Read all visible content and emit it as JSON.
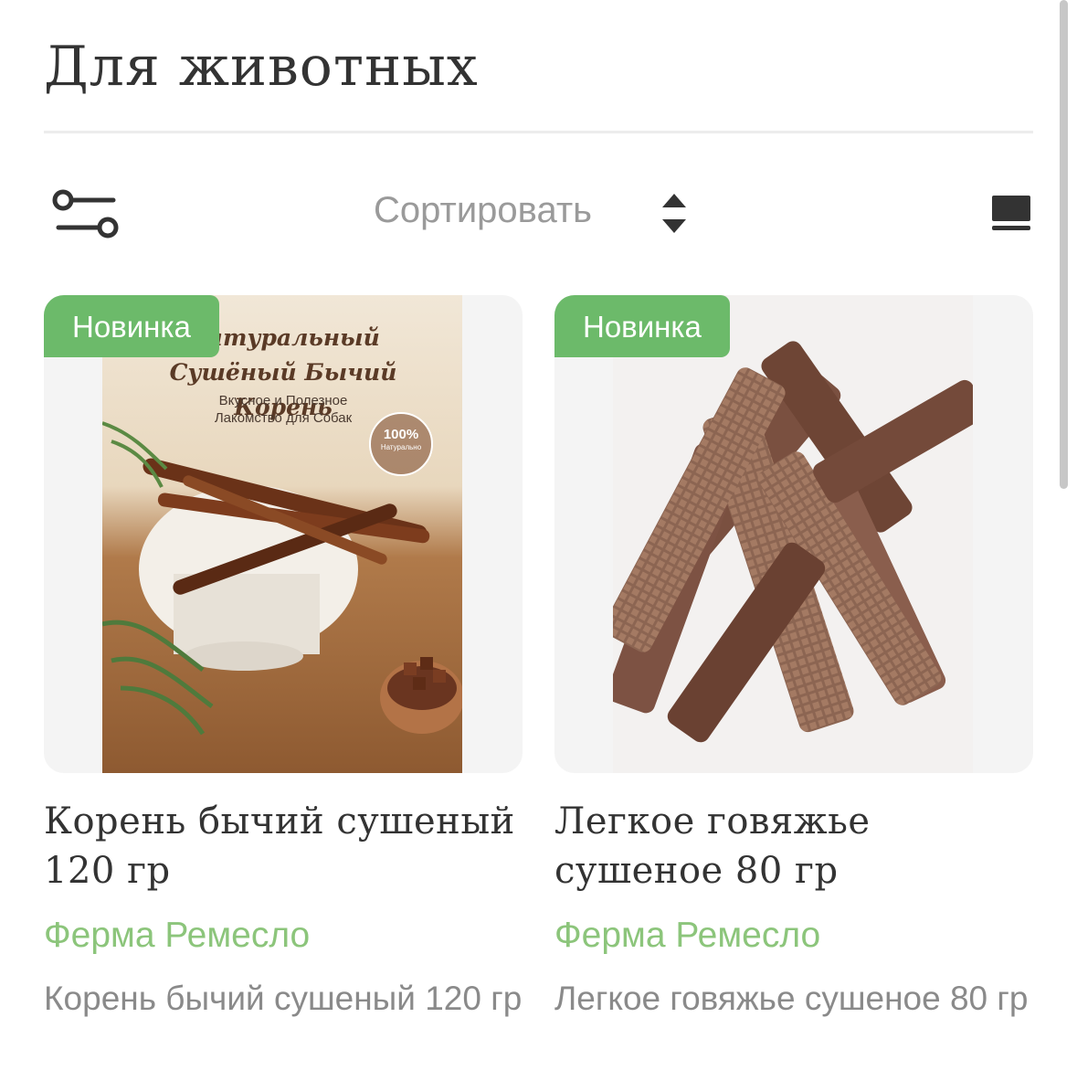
{
  "page": {
    "title": "Для животных"
  },
  "toolbar": {
    "filter_icon": "sliders-icon",
    "sort_label": "Сортировать",
    "sort_icon": "sort-up-down-icon",
    "view_icon": "view-mode-icon"
  },
  "colors": {
    "accent": "#6cba6a",
    "brand_text": "#8cc57b",
    "text": "#333333",
    "muted": "#8a8a8a"
  },
  "products": [
    {
      "badge": "Новинка",
      "title": "Корень бычий сушеный 120 гр",
      "brand": "Ферма Ремесло",
      "description": "Корень бычий сушеный 120 гр",
      "image": {
        "heading_line1": "Натуральный",
        "heading_line2": "Сушёный Бычий Корень",
        "subtitle_line1": "Вкусное и Полезное",
        "subtitle_line2": "Лакомство для Собак",
        "seal_value": "100%",
        "seal_text": "Натурально"
      }
    },
    {
      "badge": "Новинка",
      "title": "Легкое говяжье сушеное 80 гр",
      "brand": "Ферма Ремесло",
      "description": "Легкое говяжье сушеное 80 гр"
    }
  ]
}
